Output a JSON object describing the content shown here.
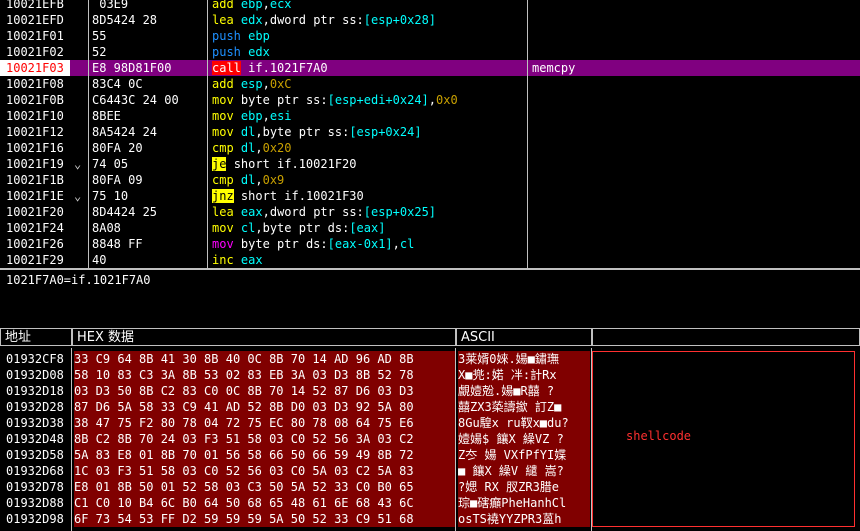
{
  "disasm": {
    "rows": [
      {
        "addr": "10021EFB",
        "hex": " 03E9",
        "tokens": [
          [
            "m-add",
            "add"
          ],
          [
            "sp",
            " "
          ],
          [
            "op-reg",
            "ebp"
          ],
          [
            "sp",
            ","
          ],
          [
            "op-reg",
            "ecx"
          ]
        ],
        "comment": "",
        "jmark": ""
      },
      {
        "addr": "10021EFD",
        "hex": "8D5424 28",
        "tokens": [
          [
            "m-lea",
            "lea"
          ],
          [
            "sp",
            " "
          ],
          [
            "op-reg",
            "edx"
          ],
          [
            "sp",
            ","
          ],
          [
            "op-lbl",
            "dword ptr ss:"
          ],
          [
            "op-mem",
            "[esp+0x28]"
          ]
        ],
        "comment": "",
        "jmark": ""
      },
      {
        "addr": "10021F01",
        "hex": "55",
        "tokens": [
          [
            "m-push",
            "push"
          ],
          [
            "sp",
            " "
          ],
          [
            "op-reg",
            "ebp"
          ]
        ],
        "comment": "",
        "jmark": ""
      },
      {
        "addr": "10021F02",
        "hex": "52",
        "tokens": [
          [
            "m-push",
            "push"
          ],
          [
            "sp",
            " "
          ],
          [
            "op-reg",
            "edx"
          ]
        ],
        "comment": "",
        "jmark": ""
      },
      {
        "addr": "10021F03",
        "hex": "E8 98D81F00",
        "tokens": [
          [
            "m-call",
            "call"
          ],
          [
            "sp",
            " "
          ],
          [
            "op-lbl",
            "if.1021F7A0"
          ]
        ],
        "comment": "memcpy",
        "jmark": "",
        "selected": true
      },
      {
        "addr": "10021F08",
        "hex": "83C4 0C",
        "tokens": [
          [
            "m-add",
            "add"
          ],
          [
            "sp",
            " "
          ],
          [
            "op-reg",
            "esp"
          ],
          [
            "sp",
            ","
          ],
          [
            "op-num",
            "0xC"
          ]
        ],
        "comment": "",
        "jmark": ""
      },
      {
        "addr": "10021F0B",
        "hex": "C6443C 24 00",
        "tokens": [
          [
            "m-mov",
            "mov"
          ],
          [
            "sp",
            " "
          ],
          [
            "op-lbl",
            "byte ptr ss:"
          ],
          [
            "op-mem",
            "[esp+edi+0x24]"
          ],
          [
            "sp",
            ","
          ],
          [
            "op-num",
            "0x0"
          ]
        ],
        "comment": "",
        "jmark": ""
      },
      {
        "addr": "10021F10",
        "hex": "8BEE",
        "tokens": [
          [
            "m-mov",
            "mov"
          ],
          [
            "sp",
            " "
          ],
          [
            "op-reg",
            "ebp"
          ],
          [
            "sp",
            ","
          ],
          [
            "op-reg",
            "esi"
          ]
        ],
        "comment": "",
        "jmark": ""
      },
      {
        "addr": "10021F12",
        "hex": "8A5424 24",
        "tokens": [
          [
            "m-mov",
            "mov"
          ],
          [
            "sp",
            " "
          ],
          [
            "op-reg",
            "dl"
          ],
          [
            "sp",
            ","
          ],
          [
            "op-lbl",
            "byte ptr ss:"
          ],
          [
            "op-mem",
            "[esp+0x24]"
          ]
        ],
        "comment": "",
        "jmark": ""
      },
      {
        "addr": "10021F16",
        "hex": "80FA 20",
        "tokens": [
          [
            "m-cmp",
            "cmp"
          ],
          [
            "sp",
            " "
          ],
          [
            "op-reg",
            "dl"
          ],
          [
            "sp",
            ","
          ],
          [
            "op-num",
            "0x20"
          ]
        ],
        "comment": "",
        "jmark": ""
      },
      {
        "addr": "10021F19",
        "hex": "74 05",
        "tokens": [
          [
            "m-jmp",
            "je"
          ],
          [
            "sp",
            " "
          ],
          [
            "op-lbl",
            "short if.10021F20"
          ]
        ],
        "comment": "",
        "jmark": "⌄"
      },
      {
        "addr": "10021F1B",
        "hex": "80FA 09",
        "tokens": [
          [
            "m-cmp",
            "cmp"
          ],
          [
            "sp",
            " "
          ],
          [
            "op-reg",
            "dl"
          ],
          [
            "sp",
            ","
          ],
          [
            "op-num",
            "0x9"
          ]
        ],
        "comment": "",
        "jmark": ""
      },
      {
        "addr": "10021F1E",
        "hex": "75 10",
        "tokens": [
          [
            "m-jmp",
            "jnz"
          ],
          [
            "sp",
            " "
          ],
          [
            "op-lbl",
            "short if.10021F30"
          ]
        ],
        "comment": "",
        "jmark": "⌄"
      },
      {
        "addr": "10021F20",
        "hex": "8D4424 25",
        "tokens": [
          [
            "m-lea",
            "lea"
          ],
          [
            "sp",
            " "
          ],
          [
            "op-reg",
            "eax"
          ],
          [
            "sp",
            ","
          ],
          [
            "op-lbl",
            "dword ptr ss:"
          ],
          [
            "op-mem",
            "[esp+0x25]"
          ]
        ],
        "comment": "",
        "jmark": ""
      },
      {
        "addr": "10021F24",
        "hex": "8A08",
        "tokens": [
          [
            "m-mov",
            "mov"
          ],
          [
            "sp",
            " "
          ],
          [
            "op-reg",
            "cl"
          ],
          [
            "sp",
            ","
          ],
          [
            "op-lbl",
            "byte ptr ds:"
          ],
          [
            "op-mem",
            "[eax]"
          ]
        ],
        "comment": "",
        "jmark": ""
      },
      {
        "addr": "10021F26",
        "hex": "8848 FF",
        "tokens": [
          [
            "m-mov b2",
            "mov"
          ],
          [
            "sp",
            " "
          ],
          [
            "op-lbl",
            "byte ptr ds:"
          ],
          [
            "op-mem",
            "[eax-0x1]"
          ],
          [
            "sp",
            ","
          ],
          [
            "op-reg",
            "cl"
          ]
        ],
        "comment": "",
        "jmark": ""
      },
      {
        "addr": "10021F29",
        "hex": "40",
        "tokens": [
          [
            "m-inc",
            "inc"
          ],
          [
            "sp",
            " "
          ],
          [
            "op-reg",
            "eax"
          ]
        ],
        "comment": "",
        "jmark": ""
      }
    ]
  },
  "info": {
    "text": "1021F7A0=if.1021F7A0"
  },
  "dump_headers": {
    "address": "地址",
    "hex": "HEX 数据",
    "ascii": "ASCII"
  },
  "dump": {
    "rows": [
      {
        "addr": "01932CF8",
        "hex": "33 C9 64 8B 41 30 8B 40 0C 8B 70 14 AD 96 AD 8B",
        "ascii": "3莱婿0婡.婸■鏽璑"
      },
      {
        "addr": "01932D08",
        "hex": "58 10 83 C3 3A 8B 53 02 83 EB 3A 03 D3 8B 52 78",
        "ascii": "X■兠:婼 冸:計Rx"
      },
      {
        "addr": "01932D18",
        "hex": "03 D3 50 8B C2 83 C0 0C 8B 70 14 52 87 D6 03 D3",
        "ascii": "覰嬄兝.婸■R囍 ?"
      },
      {
        "addr": "01932D28",
        "hex": "87 D6 5A 58 33 C9 41 AD 52 8B D0 03 D3 92 5A 80",
        "ascii": "囍ZX3蒅譸撳 訂Z■"
      },
      {
        "addr": "01932D38",
        "hex": "38 47 75 F2 80 78 04 72 75 EC 80 78 08 64 75 E6",
        "ascii": "8Gu騜x ru靫x■du?"
      },
      {
        "addr": "01932D48",
        "hex": "8B C2 8B 70 24 03 F3 51 58 03 C0 52 56 3A 03 C2",
        "ascii": "嬄婸$ 饟X 繰VZ ?"
      },
      {
        "addr": "01932D58",
        "hex": "5A 83 E8 01 8B 70 01 56 58 66 50 66 59 49 8B 72",
        "ascii": "Z冭 婸 VXfPfYI媟"
      },
      {
        "addr": "01932D68",
        "hex": "1C 03 F3 51 58 03 C0 52 56 03 C0 5A 03 C2 5A 83",
        "ascii": "■ 饟X 繰V 繾 嵩?"
      },
      {
        "addr": "01932D78",
        "hex": "E8 01 8B 50 01 52 58 03 C3 50 5A 52 33 C0 B0 65",
        "ascii": "?媤 RX 肞ZR3腊e"
      },
      {
        "addr": "01932D88",
        "hex": "C1 C0 10 B4 6C B0 64 50 68 65 48 61 6E 68 43 6C",
        "ascii": "琮■磍癲PheHanhCl"
      },
      {
        "addr": "01932D98",
        "hex": "6F 73 54 53 FF D2 59 59 59 5A 50 52 33 C9 51 68",
        "ascii": "osTS襓YYZPR3蒕h"
      }
    ]
  },
  "annotation": {
    "label": "shellcode",
    "color": "#ff3030"
  }
}
